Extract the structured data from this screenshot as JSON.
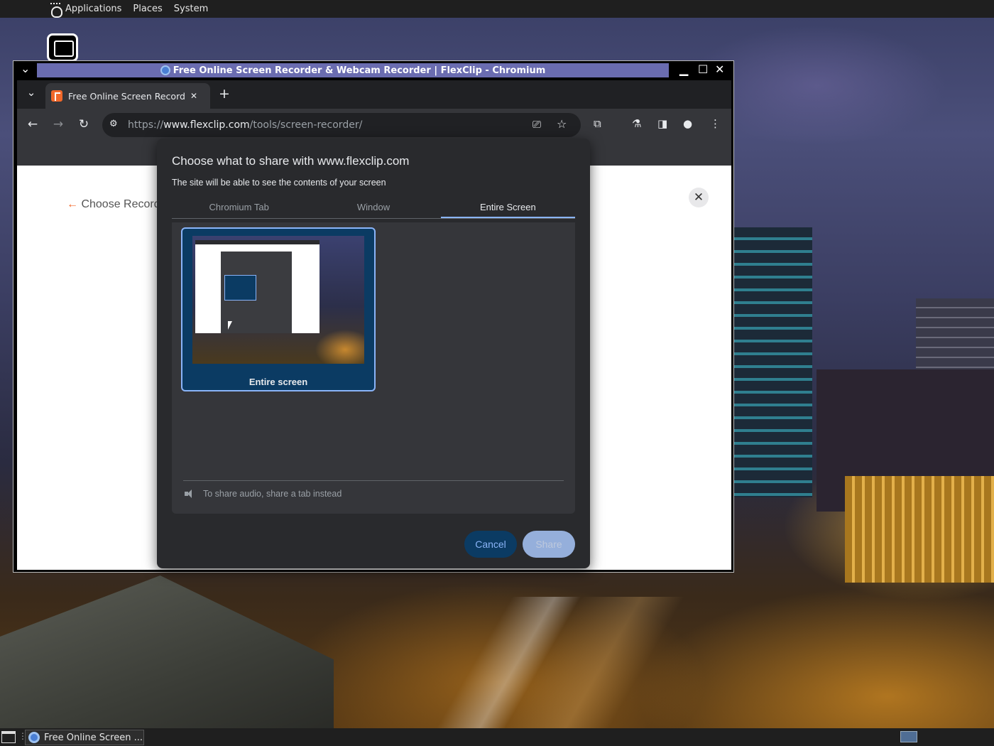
{
  "top_panel": {
    "applications": "Applications",
    "places": "Places",
    "system": "System"
  },
  "window": {
    "title": "Free Online Screen Recorder & Webcam Recorder | FlexClip - Chromium",
    "menu_glyph": "⌄",
    "minimize_glyph": "▁",
    "maximize_glyph": "☐",
    "close_glyph": "✕"
  },
  "browser": {
    "tab_title": "Free Online Screen Recorder",
    "tab_close": "✕",
    "new_tab": "+",
    "tab_search": "⌄",
    "url_scheme": "https://",
    "url_host": "www.flexclip.com",
    "url_path": "/tools/screen-recorder/",
    "back": "←",
    "forward": "→",
    "reload": "↻",
    "menu": "⋮"
  },
  "page": {
    "back_arrow": "←",
    "back_label": "Choose Record",
    "close_glyph": "✕"
  },
  "dialog": {
    "title": "Choose what to share with www.flexclip.com",
    "subtitle": "The site will be able to see the contents of your screen",
    "tabs": [
      "Chromium Tab",
      "Window",
      "Entire Screen"
    ],
    "source_label": "Entire screen",
    "audio_note": "To share audio, share a tab instead",
    "cancel": "Cancel",
    "share": "Share",
    "accent_color": "#8ab4f8"
  },
  "taskbar": {
    "task_label": "Free Online Screen ..."
  }
}
